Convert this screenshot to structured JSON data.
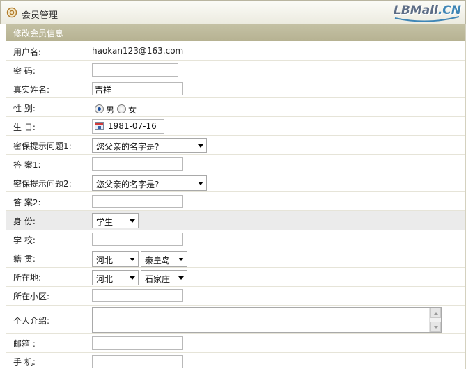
{
  "header": {
    "title": "会员管理",
    "logo_main": "LBMall",
    "logo_suffix": ".CN"
  },
  "section_title": "修改会员信息",
  "form": {
    "username": {
      "label": "用户名:",
      "value": "haokan123@163.com"
    },
    "password": {
      "label": "密  码:",
      "value": ""
    },
    "realname": {
      "label": "真实姓名:",
      "value": "吉祥"
    },
    "gender": {
      "label": "性  别:",
      "options": [
        "男",
        "女"
      ],
      "selected": "男"
    },
    "birthday": {
      "label": "生  日:",
      "value": "1981-07-16"
    },
    "question1": {
      "label": "密保提示问题1:",
      "value": "您父亲的名字是?"
    },
    "answer1": {
      "label": "答  案1:",
      "value": ""
    },
    "question2": {
      "label": "密保提示问题2:",
      "value": "您父亲的名字是?"
    },
    "answer2": {
      "label": "答  案2:",
      "value": ""
    },
    "identity": {
      "label": "身  份:",
      "value": "学生"
    },
    "school": {
      "label": "学  校:",
      "value": ""
    },
    "native_place": {
      "label": "籍  贯:",
      "province": "河北",
      "city": "秦皇岛"
    },
    "location": {
      "label": "所在地:",
      "province": "河北",
      "city": "石家庄"
    },
    "community": {
      "label": "所在小区:",
      "value": ""
    },
    "intro": {
      "label": "个人介绍:",
      "value": ""
    },
    "email": {
      "label": "邮箱 :",
      "value": ""
    },
    "mobile": {
      "label": "手  机:",
      "value": ""
    }
  },
  "colors": {
    "subhead_bg": "#b9b596",
    "row_border": "#e6e4d8",
    "shaded_row": "#ebebeb",
    "logo_blue": "#3f86b6"
  }
}
